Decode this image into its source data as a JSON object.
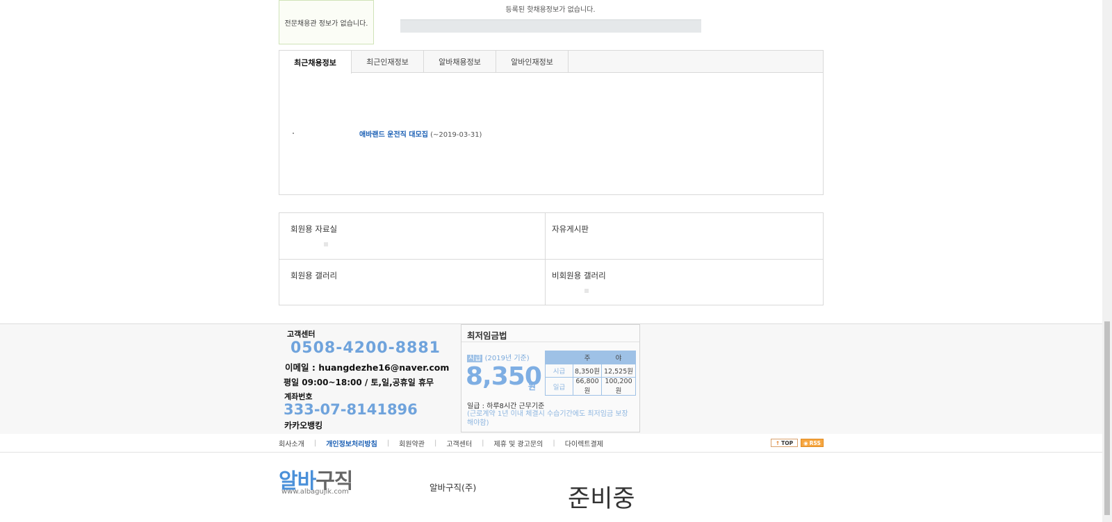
{
  "top": {
    "pro_hall_empty": "전문채용관 정보가 없습니다.",
    "hot_jobs_empty": "등록된 핫채용정보가 없습니다."
  },
  "tabs": [
    {
      "label": "최근채용정보"
    },
    {
      "label": "최근인재정보"
    },
    {
      "label": "알바채용정보"
    },
    {
      "label": "알바인재정보"
    }
  ],
  "recent_job": {
    "title": "애바랜드 운전직 대모집",
    "date": "(~2019-03-31)"
  },
  "boards": [
    {
      "title": "회원용 자료실"
    },
    {
      "title": "자유게시판"
    },
    {
      "title": "회원용 갤러리"
    },
    {
      "title": "비회원용 갤러리"
    }
  ],
  "customer_center": {
    "label": "고객센터",
    "phone": "0508-4200-8881",
    "email": "이메일 : huangdezhe16@naver.com",
    "hours": "평일 09:00~18:00 / 토,일,공휴일 휴무",
    "account_label": "계좌번호",
    "account_number": "333-07-8141896",
    "bank": "카카오뱅킹"
  },
  "min_wage": {
    "title": "최저임금법",
    "hourly_label": "시급",
    "year_note": "(2019년 기준)",
    "amount": "8,350",
    "unit": "원",
    "daily_basis": "일급 : 하루8시간 근무기준",
    "note": "(근로계약 1년 이내 체결시 수습기간에도 최저임금 보장해야함)",
    "table": {
      "headers": [
        "",
        "주",
        "야"
      ],
      "rows": [
        {
          "label": "시급",
          "day": "8,350원",
          "night": "12,525원"
        },
        {
          "label": "일급",
          "day": "66,800원",
          "night": "100,200원"
        }
      ]
    }
  },
  "footer_links": [
    {
      "label": "회사소개"
    },
    {
      "label": "개인정보처리방침"
    },
    {
      "label": "회원약관"
    },
    {
      "label": "고객센터"
    },
    {
      "label": "제휴 및 광고문의"
    },
    {
      "label": "다이렉트결제"
    }
  ],
  "badges": {
    "top": "TOP",
    "rss": "RSS"
  },
  "logo": {
    "part1": "알바",
    "part2": "구직",
    "url": "www.albagujik.com"
  },
  "company_name": "알바구직(주)",
  "preparing": "준비중"
}
